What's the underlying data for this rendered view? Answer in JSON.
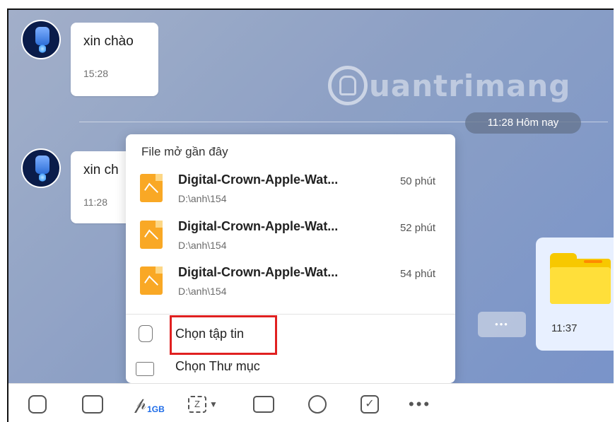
{
  "chat": {
    "messages": [
      {
        "text": "xin chào",
        "time": "15:28"
      },
      {
        "text": "xin ch",
        "time": "11:28"
      }
    ],
    "day_divider": "11:28 Hôm nay",
    "watermark": "uantrimang",
    "file_message_time": "11:37",
    "pending_dots": "•••"
  },
  "attach_menu": {
    "title": "File mở gần đây",
    "recent_files": [
      {
        "name": "Digital-Crown-Apple-Wat...",
        "path": "D:\\anh\\154",
        "time": "50 phút"
      },
      {
        "name": "Digital-Crown-Apple-Wat...",
        "path": "D:\\anh\\154",
        "time": "52 phút"
      },
      {
        "name": "Digital-Crown-Apple-Wat...",
        "path": "D:\\anh\\154",
        "time": "54 phút"
      }
    ],
    "choose_file": "Chọn tập tin",
    "choose_folder": "Chọn Thư mục"
  },
  "toolbar": {
    "attach_size": "1GB",
    "more": "•••",
    "icons": [
      "sticker-icon",
      "image-icon",
      "paperclip-icon",
      "screenshot-icon",
      "contact-card-icon",
      "alarm-icon",
      "task-icon",
      "more-icon"
    ]
  },
  "colors": {
    "highlight_border": "#e02020",
    "file_icon": "#f9a825",
    "folder": "#f7c800",
    "accent_blue": "#1e6ce8"
  }
}
